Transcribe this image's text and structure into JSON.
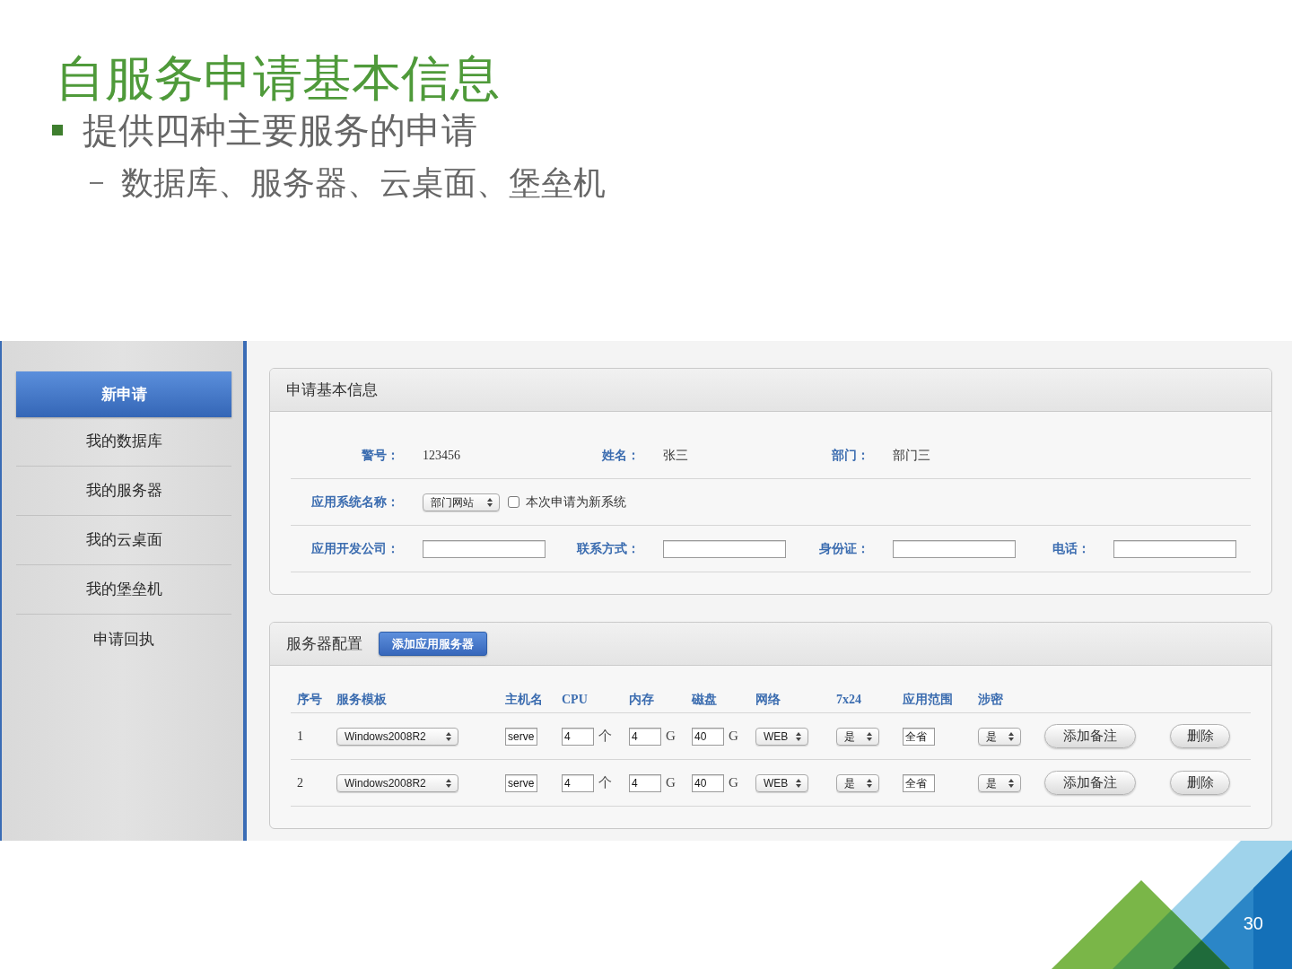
{
  "slide": {
    "title": "自服务申请基本信息",
    "bullets": [
      {
        "text": "提供四种主要服务的申请",
        "children": [
          {
            "text": "数据库、服务器、云桌面、堡垒机"
          }
        ]
      }
    ],
    "page_number": "30"
  },
  "sidebar": {
    "items": [
      {
        "label": "新申请",
        "selected": true
      },
      {
        "label": "我的数据库",
        "selected": false
      },
      {
        "label": "我的服务器",
        "selected": false
      },
      {
        "label": "我的云桌面",
        "selected": false
      },
      {
        "label": "我的堡垒机",
        "selected": false
      },
      {
        "label": "申请回执",
        "selected": false
      }
    ]
  },
  "basic_info": {
    "title": "申请基本信息",
    "rows": [
      {
        "fields": [
          {
            "kind": "text",
            "label": "警号：",
            "value": "123456"
          },
          {
            "kind": "text",
            "label": "姓名：",
            "value": "张三"
          },
          {
            "kind": "text",
            "label": "部门：",
            "value": "部门三"
          }
        ]
      },
      {
        "fields": [
          {
            "kind": "select",
            "label": "应用系统名称：",
            "value": "部门网站",
            "option": {
              "label": "本次申请为新系统",
              "checked": false
            }
          }
        ]
      },
      {
        "fields": [
          {
            "kind": "input",
            "label": "应用开发公司："
          },
          {
            "kind": "input",
            "label": "联系方式："
          },
          {
            "kind": "input",
            "label": "身份证："
          },
          {
            "kind": "input",
            "label": "电话："
          }
        ]
      }
    ]
  },
  "server_config": {
    "title": "服务器配置",
    "add_button": "添加应用服务器",
    "columns": [
      "序号",
      "服务模板",
      "主机名",
      "CPU",
      "内存",
      "磁盘",
      "网络",
      "7x24",
      "应用范围",
      "涉密"
    ],
    "rows": [
      {
        "cells": [
          {
            "kind": "text",
            "value": "1"
          },
          {
            "kind": "select",
            "value": "Windows2008R2"
          },
          {
            "kind": "input",
            "value": "serve"
          },
          {
            "kind": "input",
            "value": "4",
            "unit": "个"
          },
          {
            "kind": "input",
            "value": "4",
            "unit": "G"
          },
          {
            "kind": "input",
            "value": "40",
            "unit": "G"
          },
          {
            "kind": "select",
            "value": "WEB"
          },
          {
            "kind": "select",
            "value": "是"
          },
          {
            "kind": "input",
            "value": "全省"
          },
          {
            "kind": "select",
            "value": "是"
          },
          {
            "kind": "button",
            "value": "添加备注"
          },
          {
            "kind": "button",
            "value": "删除"
          }
        ]
      },
      {
        "cells": [
          {
            "kind": "text",
            "value": "2"
          },
          {
            "kind": "select",
            "value": "Windows2008R2"
          },
          {
            "kind": "input",
            "value": "serve"
          },
          {
            "kind": "input",
            "value": "4",
            "unit": "个"
          },
          {
            "kind": "input",
            "value": "4",
            "unit": "G"
          },
          {
            "kind": "input",
            "value": "40",
            "unit": "G"
          },
          {
            "kind": "select",
            "value": "WEB"
          },
          {
            "kind": "select",
            "value": "是"
          },
          {
            "kind": "input",
            "value": "全省"
          },
          {
            "kind": "select",
            "value": "是"
          },
          {
            "kind": "button",
            "value": "添加备注"
          },
          {
            "kind": "button",
            "value": "删除"
          }
        ]
      }
    ]
  }
}
